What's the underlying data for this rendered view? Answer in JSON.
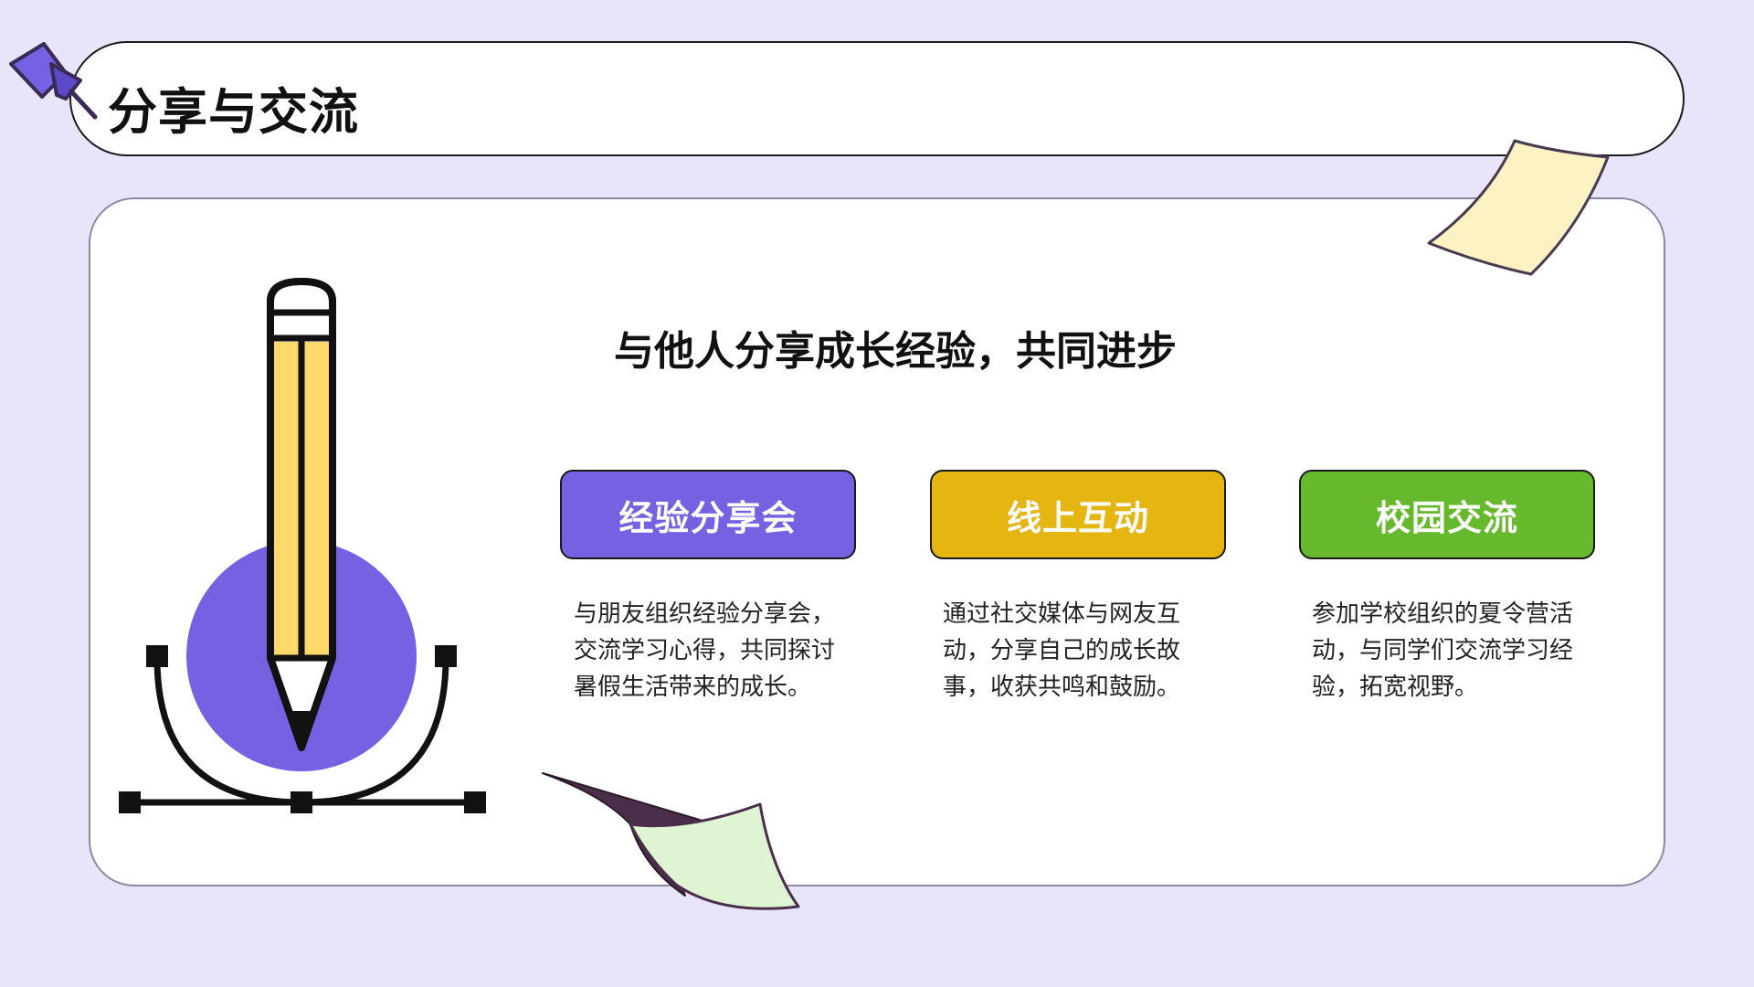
{
  "header": {
    "title": "分享与交流"
  },
  "main": {
    "subtitle": "与他人分享成长经验，共同进步",
    "cards": [
      {
        "label": "经验分享会",
        "color": "#7462e3",
        "description": "与朋友组织经验分享会，交流学习心得，共同探讨暑假生活带来的成长。"
      },
      {
        "label": "线上互动",
        "color": "#e5b511",
        "description": "通过社交媒体与网友互动，分享自己的成长故事，收获共鸣和鼓励。"
      },
      {
        "label": "校园交流",
        "color": "#66b92d",
        "description": "参加学校组织的夏令营活动，与同学们交流学习经验，拓宽视野。"
      }
    ]
  },
  "theme": {
    "background": "#e8e5fa",
    "accent_purple": "#7462e3",
    "accent_yellow": "#e5b511",
    "accent_green": "#66b92d",
    "pencil_yellow": "#fdd86b",
    "sticky_note_yellow": "#fdf2c4",
    "sticky_note_green": "#dff4d3"
  },
  "icons": {
    "pin": "pushpin-icon",
    "pencil": "pencil-bezier-icon",
    "note_top": "sticky-note-icon",
    "note_bottom": "curled-note-icon"
  }
}
